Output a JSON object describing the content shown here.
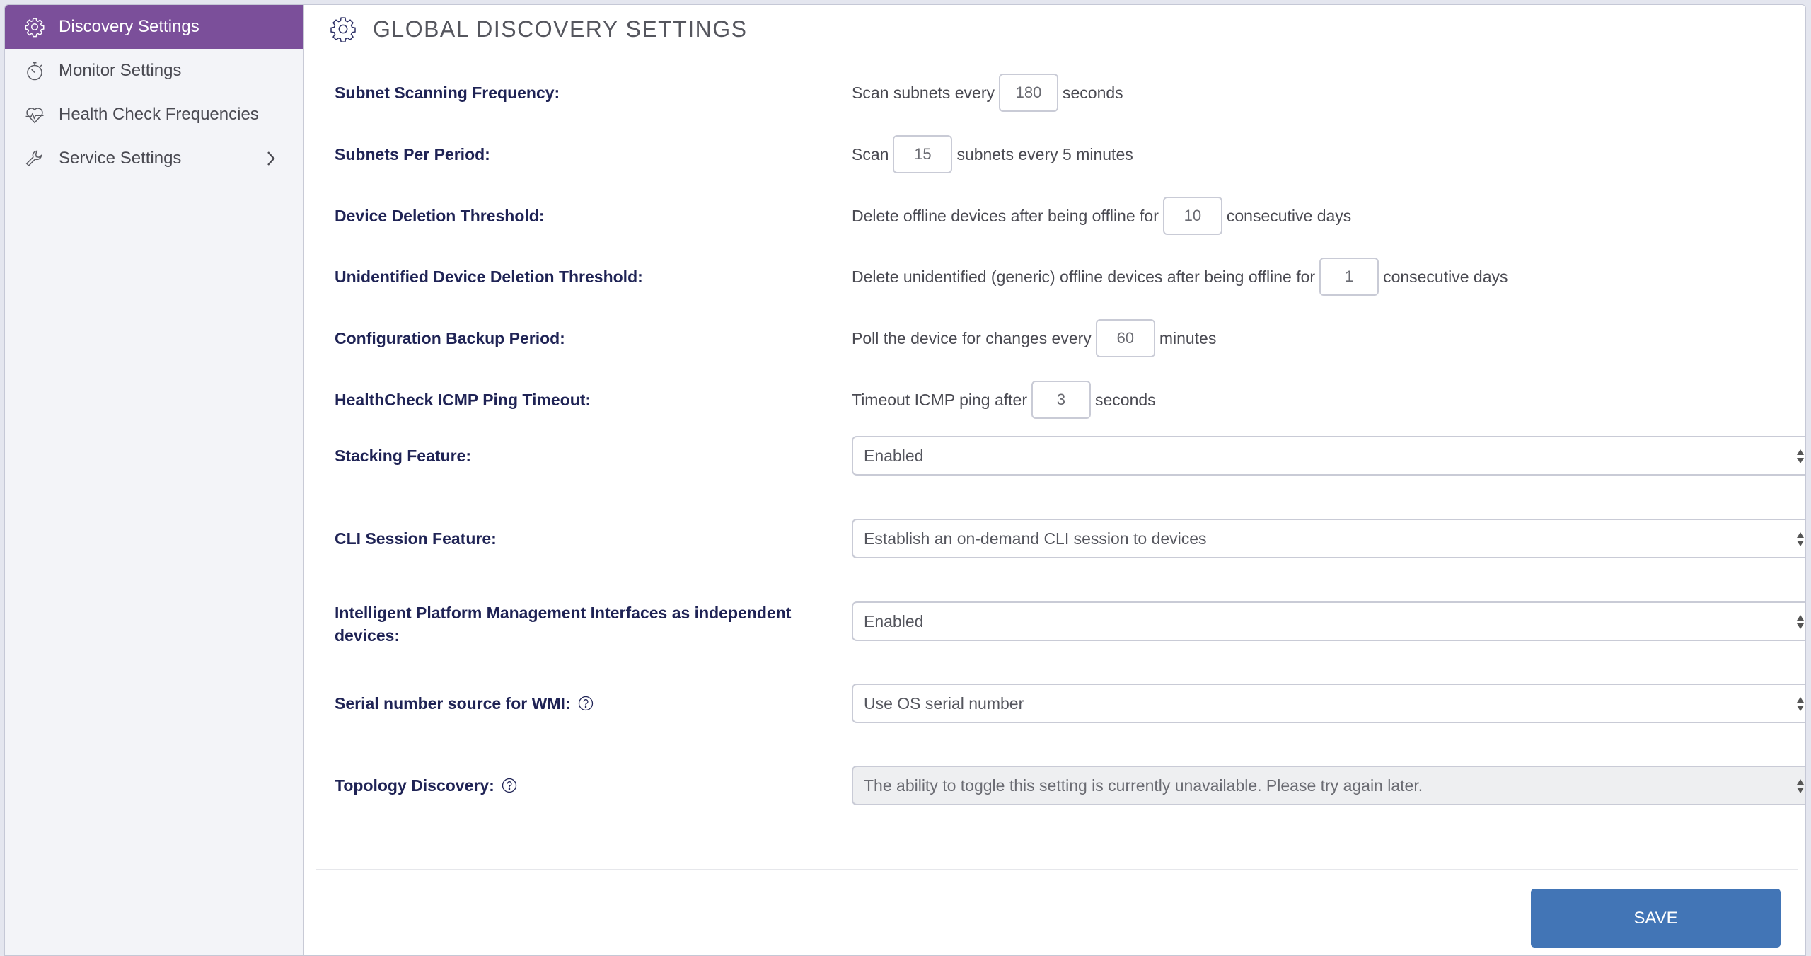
{
  "sidebar": {
    "items": [
      {
        "label": "Discovery Settings",
        "icon": "gear-icon",
        "active": true
      },
      {
        "label": "Monitor Settings",
        "icon": "stopwatch-icon"
      },
      {
        "label": "Health Check Frequencies",
        "icon": "heartbeat-icon"
      },
      {
        "label": "Service Settings",
        "icon": "wrench-icon",
        "has_submenu": true
      }
    ]
  },
  "header": {
    "title": "GLOBAL DISCOVERY SETTINGS",
    "icon": "gear-icon"
  },
  "settings": {
    "subnet_scanning_frequency": {
      "label": "Subnet Scanning Frequency:",
      "prefix": "Scan subnets every",
      "value": "180",
      "suffix": "seconds"
    },
    "subnets_per_period": {
      "label": "Subnets Per Period:",
      "prefix": "Scan",
      "value": "15",
      "suffix": "subnets every 5 minutes"
    },
    "device_deletion_threshold": {
      "label": "Device Deletion Threshold:",
      "prefix": "Delete offline devices after being offline for",
      "value": "10",
      "suffix": "consecutive days"
    },
    "unidentified_device_deletion_threshold": {
      "label": "Unidentified Device Deletion Threshold:",
      "prefix": "Delete unidentified (generic) offline devices after being offline for",
      "value": "1",
      "suffix": "consecutive days"
    },
    "configuration_backup_period": {
      "label": "Configuration Backup Period:",
      "prefix": "Poll the device for changes every",
      "value": "60",
      "suffix": "minutes"
    },
    "healthcheck_icmp_ping_timeout": {
      "label": "HealthCheck ICMP Ping Timeout:",
      "prefix": "Timeout ICMP ping after",
      "value": "3",
      "suffix": "seconds"
    },
    "stacking_feature": {
      "label": "Stacking Feature:",
      "selected": "Enabled"
    },
    "cli_session_feature": {
      "label": "CLI Session Feature:",
      "selected": "Establish an on-demand CLI session to devices"
    },
    "ipmi_independent_devices": {
      "label": "Intelligent Platform Management Interfaces as independent devices:",
      "selected": "Enabled"
    },
    "serial_number_source_wmi": {
      "label": "Serial number source for WMI:",
      "selected": "Use OS serial number",
      "has_help": true
    },
    "topology_discovery": {
      "label": "Topology Discovery:",
      "selected": "The ability to toggle this setting is currently unavailable. Please try again later.",
      "disabled": true,
      "has_help": true
    }
  },
  "footer": {
    "save_label": "SAVE"
  },
  "colors": {
    "accent_purple": "#7b4f9a",
    "save_blue": "#4275b6",
    "label_navy": "#1f2355"
  }
}
